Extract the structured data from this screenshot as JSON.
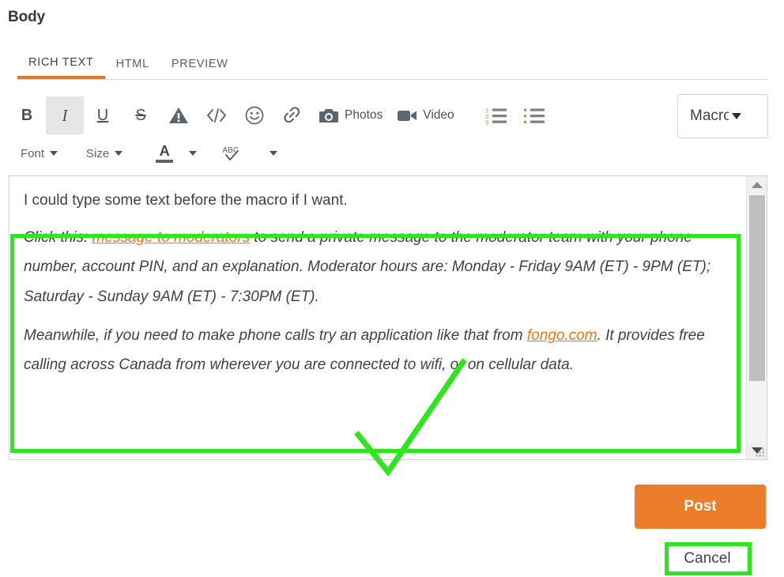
{
  "page": {
    "title": "Body"
  },
  "tabs": [
    {
      "label": "RICH TEXT",
      "active": true
    },
    {
      "label": "HTML",
      "active": false
    },
    {
      "label": "PREVIEW",
      "active": false
    }
  ],
  "toolbar": {
    "row1": [
      {
        "name": "bold",
        "icon": "bold-icon",
        "label": "B"
      },
      {
        "name": "italic",
        "icon": "italic-icon",
        "label": "I"
      },
      {
        "name": "underline",
        "icon": "underline-icon",
        "label": "U"
      },
      {
        "name": "strikethrough",
        "icon": "strikethrough-icon",
        "label": "S"
      },
      {
        "name": "spoiler",
        "icon": "warning-triangle-icon",
        "label": ""
      },
      {
        "name": "code",
        "icon": "code-brackets-icon",
        "label": ""
      },
      {
        "name": "emoji",
        "icon": "smiley-face-icon",
        "label": ""
      },
      {
        "name": "link",
        "icon": "link-chain-icon",
        "label": ""
      },
      {
        "name": "photos",
        "icon": "camera-icon",
        "label": "Photos"
      },
      {
        "name": "video",
        "icon": "video-camera-icon",
        "label": "Video"
      },
      {
        "name": "ordered-list",
        "icon": "numbered-list-icon",
        "label": ""
      },
      {
        "name": "bullet-list",
        "icon": "bulleted-list-icon",
        "label": ""
      }
    ],
    "row2": [
      {
        "name": "font",
        "label": "Font",
        "icon": "chevron-down-icon"
      },
      {
        "name": "size",
        "label": "Size",
        "icon": "chevron-down-icon"
      },
      {
        "name": "text-color",
        "label": "A",
        "icon": "chevron-down-icon"
      },
      {
        "name": "spellcheck",
        "label": "",
        "icon": "spellcheck-abc-icon"
      }
    ],
    "macro_select": {
      "value": "Macro",
      "caret_icon": "caret-down-icon"
    }
  },
  "editor": {
    "plain_line": "I could type some text before the macro if I want.",
    "macro_paragraph_1": {
      "prefix": "Click this: ",
      "link": "message to moderators",
      "suffix": " to send a private message to the moderator team with your phone number, account PIN, and an explanation. Moderator hours are: Monday - Friday 9AM (ET) - 9PM (ET); Saturday - Sunday 9AM (ET) - 7:30PM (ET)."
    },
    "macro_paragraph_2": {
      "prefix": "Meanwhile, if you need to make phone calls try an application like that from ",
      "link": "fongo.com",
      "suffix": ". It provides free calling across Canada from wherever you are connected to wifi, or on cellular data."
    },
    "scrollbar": {
      "up_icon": "scroll-up-arrow-icon",
      "down_icon": "scroll-down-arrow-icon",
      "grip_icon": "resize-grip-icon"
    }
  },
  "actions": {
    "post_label": "Post",
    "cancel_label": "Cancel"
  },
  "annotations": {
    "macro_highlight": "green-rectangle-around-macro-text",
    "cancel_highlight": "green-rectangle-around-cancel-button",
    "check_arrow": "green-checkmark-annotation"
  },
  "colors": {
    "accent_orange": "#e8761f",
    "post_button": "#ea7c2a",
    "annotation_green": "#2ee61c",
    "text_dark": "#3c4348",
    "toolbar_icon": "#5a6166"
  }
}
